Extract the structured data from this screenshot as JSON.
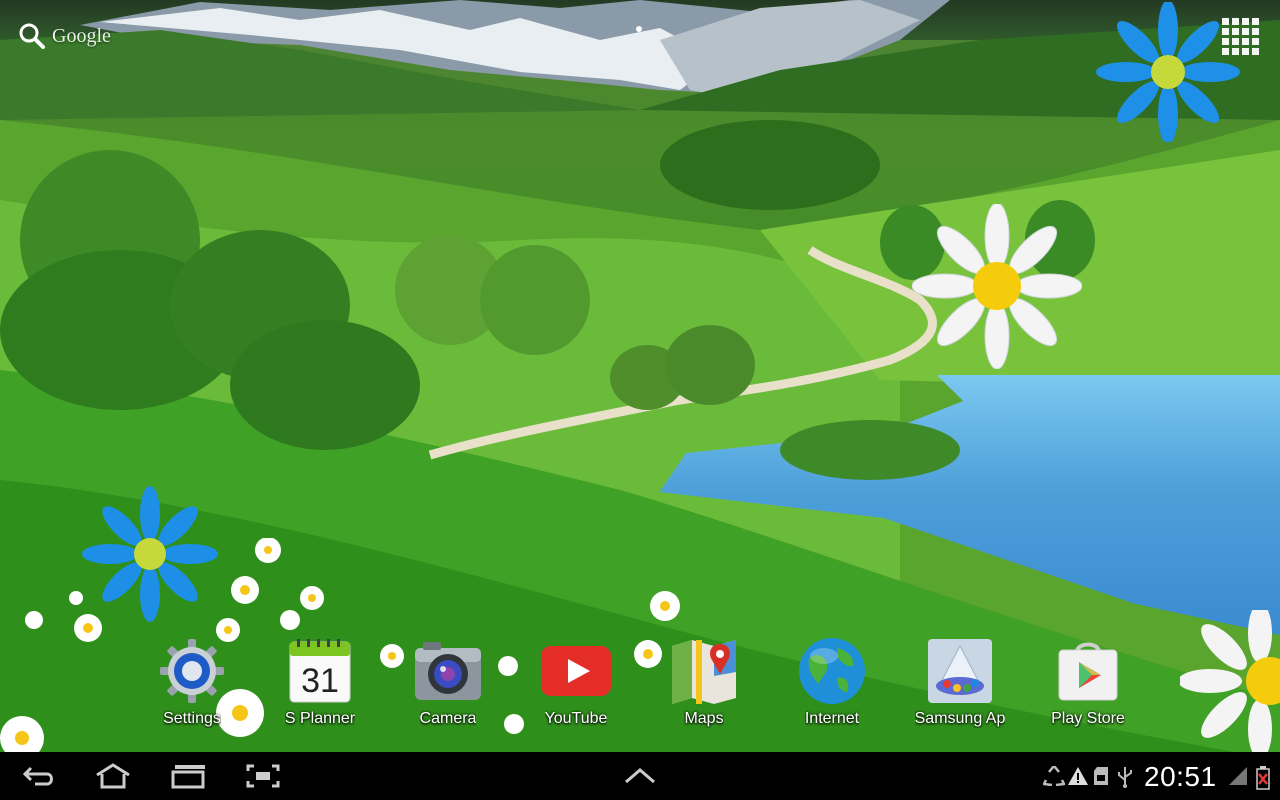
{
  "search": {
    "label": "Google",
    "icon": "search-icon"
  },
  "apps_button": {
    "icon": "apps-grid-icon"
  },
  "dock": {
    "items": [
      {
        "label": "Settings",
        "icon": "settings-gear-icon"
      },
      {
        "label": "S Planner",
        "icon": "calendar-icon",
        "calendar_day": "31"
      },
      {
        "label": "Camera",
        "icon": "camera-icon"
      },
      {
        "label": "YouTube",
        "icon": "youtube-icon"
      },
      {
        "label": "Maps",
        "icon": "maps-icon"
      },
      {
        "label": "Internet",
        "icon": "globe-icon"
      },
      {
        "label": "Samsung Ap",
        "icon": "samsung-apps-icon"
      },
      {
        "label": "Play Store",
        "icon": "play-store-icon"
      }
    ]
  },
  "navbar": {
    "back": "back-icon",
    "home": "home-icon",
    "recents": "recent-apps-icon",
    "screenshot": "screenshot-icon",
    "expand": "chevron-up-icon"
  },
  "status": {
    "time": "20:51",
    "icons": [
      "recycle-icon",
      "warning-icon",
      "sd-card-icon",
      "usb-icon",
      "signal-icon",
      "battery-icon"
    ]
  },
  "colors": {
    "grass": "#2d8d1f",
    "lake": "#4d9fd9",
    "system_bar": "#000000",
    "label_text": "#ffffff",
    "youtube_red": "#e52d27",
    "battery_warning": "#e53935"
  }
}
